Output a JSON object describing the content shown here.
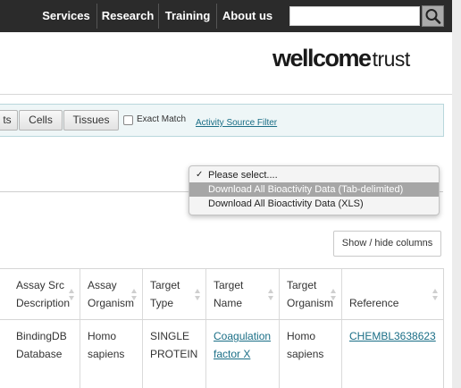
{
  "nav": {
    "items": [
      "Services",
      "Research",
      "Training",
      "About us"
    ],
    "search_placeholder": ""
  },
  "brand": {
    "bold": "wellcome",
    "light": "trust"
  },
  "filters": {
    "buttons": [
      "ts",
      "Cells",
      "Tissues"
    ],
    "exact_match_label": "Exact Match",
    "exact_match_checked": false,
    "activity_link": "Activity Source Filter"
  },
  "download_menu": {
    "options": [
      "Please select....",
      "Download All Bioactivity Data (Tab-delimited)",
      "Download All Bioactivity Data (XLS)"
    ],
    "selected_index": 0,
    "highlighted_index": 1
  },
  "show_hide_label": "Show / hide columns",
  "table": {
    "columns": [
      [
        "Assay Src",
        "Description"
      ],
      [
        "Assay",
        "Organism"
      ],
      [
        "Target",
        "Type"
      ],
      [
        "Target",
        "Name"
      ],
      [
        "Target",
        "Organism"
      ],
      [
        "Reference"
      ]
    ],
    "rows": [
      [
        [
          "BindingDB",
          "Database"
        ],
        [
          "Homo",
          "sapiens"
        ],
        [
          "SINGLE",
          "PROTEIN"
        ],
        [
          "Coagulation",
          "factor X"
        ],
        [
          "Homo",
          "sapiens"
        ],
        [
          "CHEMBL3638623"
        ]
      ]
    ],
    "link_columns": [
      3,
      5
    ]
  },
  "colors": {
    "nav_bg": "#2b2b2b",
    "link": "#1a6e86",
    "filter_bar_bg": "#eef6f7",
    "highlight": "#a6a6a6"
  }
}
